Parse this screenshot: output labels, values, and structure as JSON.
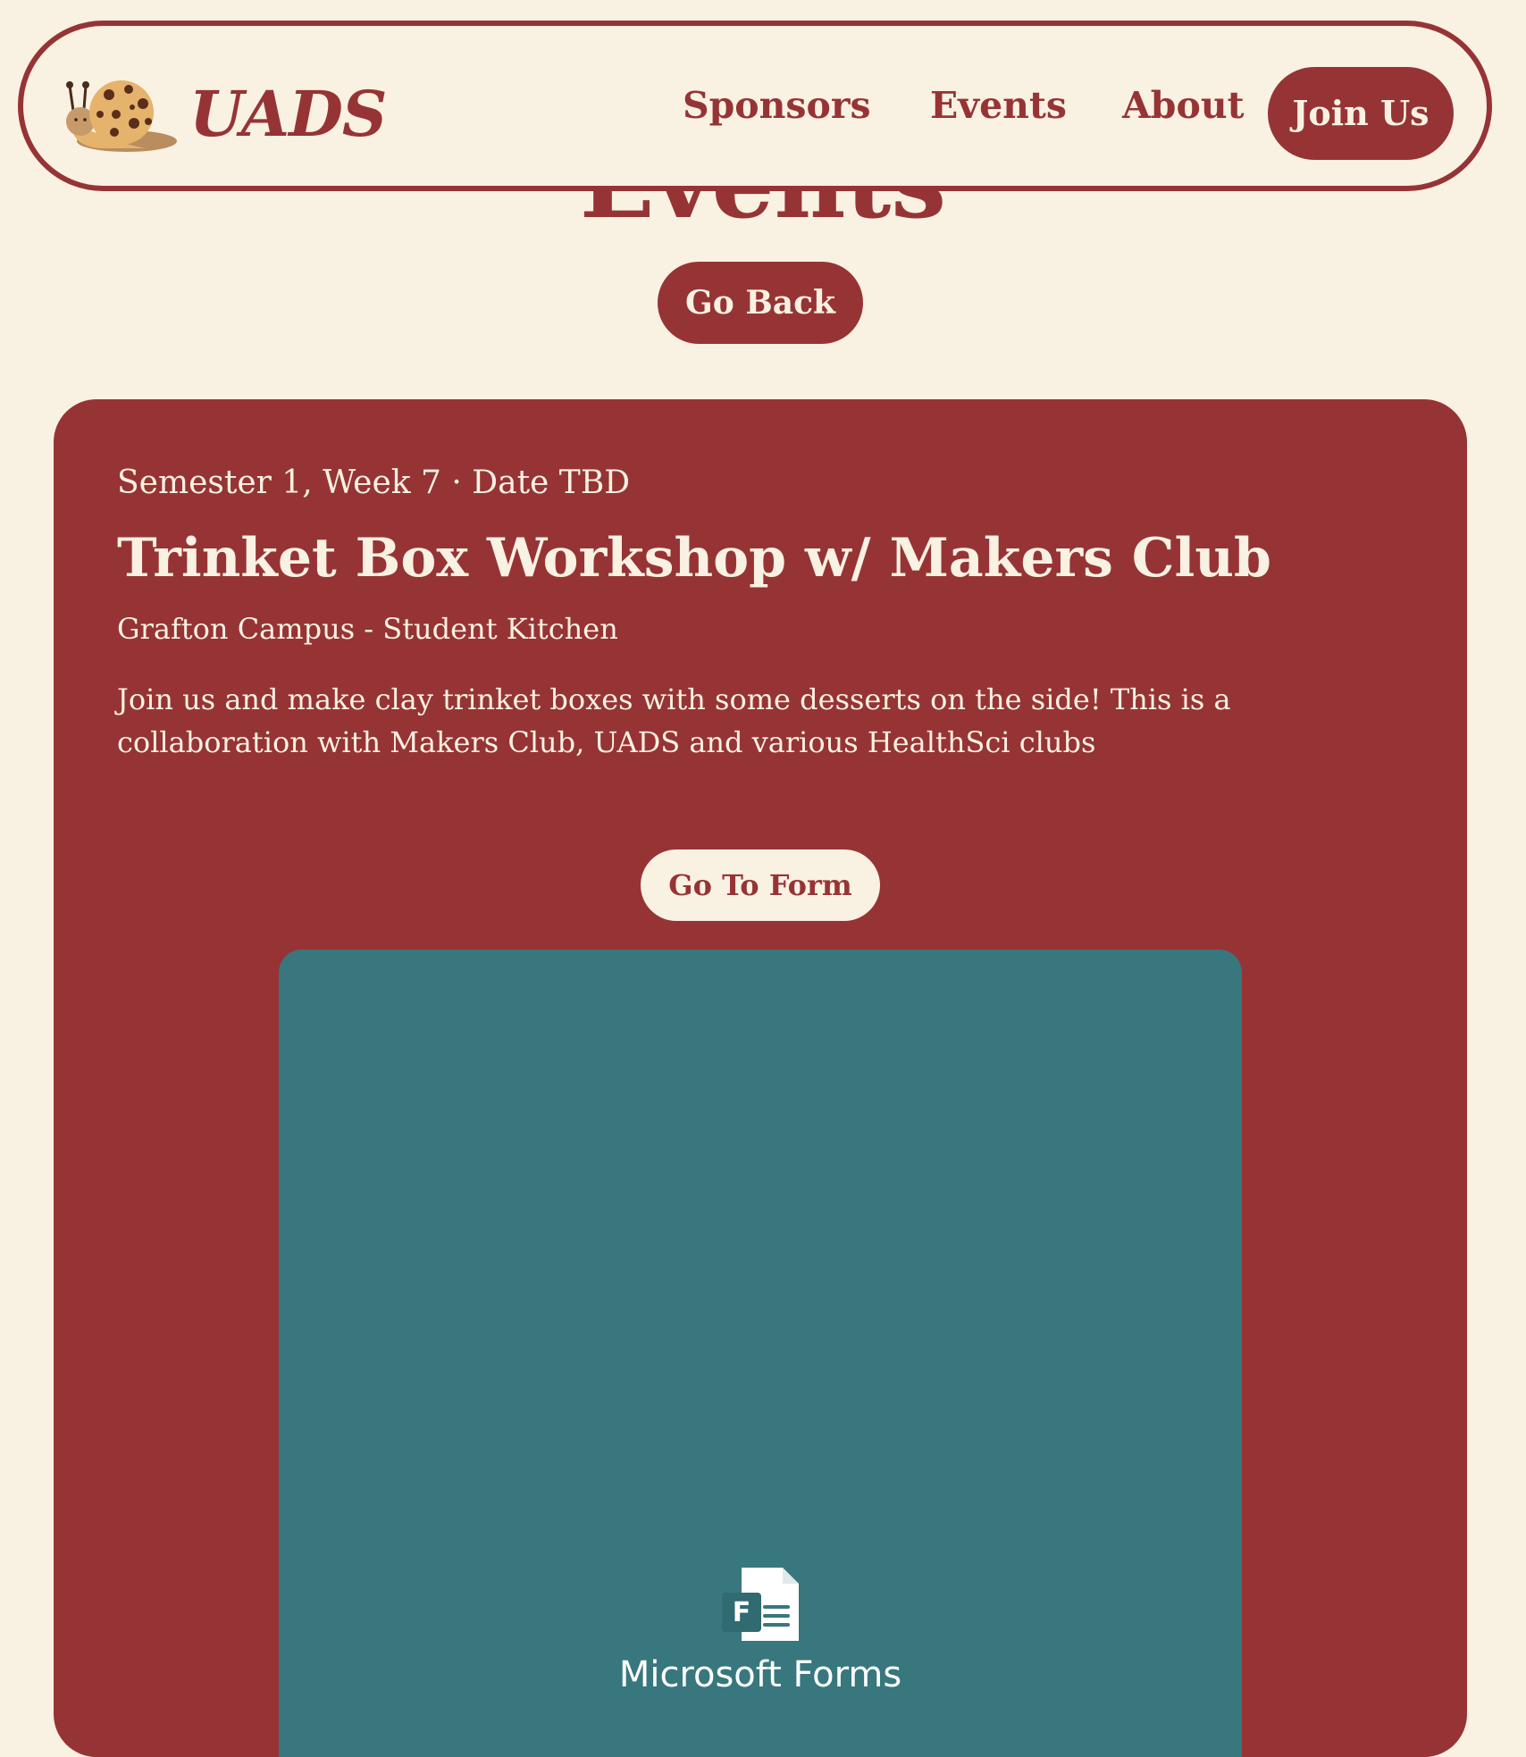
{
  "brand": {
    "name": "UADS",
    "logo_icon": "snail-cookie-icon"
  },
  "nav": {
    "links": [
      "Sponsors",
      "Events",
      "About"
    ],
    "cta": "Join Us"
  },
  "page": {
    "title": "Events",
    "back_label": "Go Back"
  },
  "event": {
    "meta": "Semester 1, Week 7 · Date TBD",
    "title": "Trinket Box Workshop w/ Makers Club",
    "location": "Grafton Campus - Student Kitchen",
    "description": "Join us and make clay trinket boxes with some desserts on the side! This is a collaboration with Makers Club, UADS and various HealthSci clubs",
    "form_button": "Go To Form"
  },
  "embed": {
    "icon": "microsoft-forms-icon",
    "label": "Microsoft Forms"
  },
  "colors": {
    "background": "#f9f1e2",
    "primary": "#963435",
    "embed_teal": "#37777d"
  }
}
